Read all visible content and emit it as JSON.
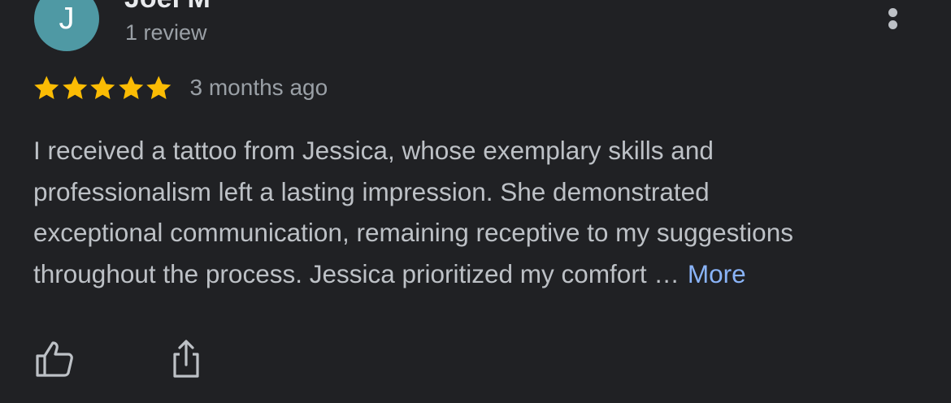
{
  "reviewer": {
    "initial": "J",
    "name": "Joel M",
    "review_count": "1 review"
  },
  "rating": {
    "stars": 5,
    "max": 5,
    "time_ago": "3 months ago"
  },
  "review": {
    "lines": [
      "I received a tattoo from Jessica, whose exemplary skills and",
      "professionalism left a lasting impression. She demonstrated",
      "exceptional communication, remaining receptive to my suggestions",
      "throughout the process. Jessica prioritized my comfort …"
    ],
    "more_label": "More"
  },
  "icons": {
    "avatar_color": "#4f99a4",
    "star_color": "#fbbc04",
    "link_color": "#8ab4f8",
    "more_options": "vertical-dots-icon",
    "like": "thumbs-up-icon",
    "share": "share-icon"
  }
}
